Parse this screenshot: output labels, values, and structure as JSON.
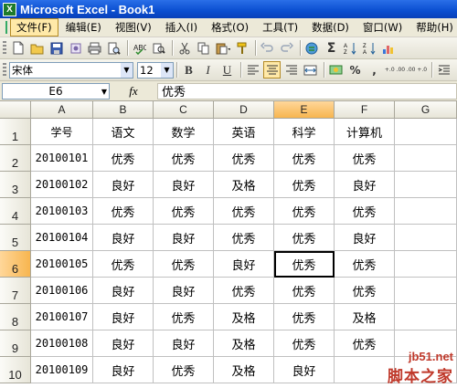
{
  "window": {
    "title": "Microsoft Excel - Book1",
    "logo": "X"
  },
  "menu": [
    "文件(F)",
    "编辑(E)",
    "视图(V)",
    "插入(I)",
    "格式(O)",
    "工具(T)",
    "数据(D)",
    "窗口(W)",
    "帮助(H)"
  ],
  "toolbar1": {
    "icons": [
      "new-icon",
      "open-icon",
      "save-icon",
      "permission-icon",
      "print-icon",
      "print-preview-icon",
      "spelling-icon",
      "research-icon",
      "cut-icon",
      "copy-icon",
      "paste-icon",
      "format-painter-icon",
      "undo-icon",
      "redo-icon",
      "hyperlink-icon",
      "autosum-icon",
      "sort-ascending-icon",
      "sort-descending-icon",
      "chart-wizard-icon"
    ],
    "autosum_glyph": "Σ"
  },
  "toolbar2": {
    "font_name": "宋体",
    "font_size": "12",
    "bold": "B",
    "italic": "I",
    "underline": "U",
    "percent": "%",
    "comma": ",",
    "inc_decimal": "+.0 .00",
    "dec_decimal": ".00 +.0"
  },
  "formula_bar": {
    "name_box": "E6",
    "fx": "fx",
    "value": "优秀"
  },
  "sheet": {
    "columns": [
      "A",
      "B",
      "C",
      "D",
      "E",
      "F",
      "G"
    ],
    "rows": [
      "1",
      "2",
      "3",
      "4",
      "5",
      "6",
      "7",
      "8",
      "9",
      "10"
    ],
    "active_cell": "E6",
    "cells": [
      [
        "学号",
        "语文",
        "数学",
        "英语",
        "科学",
        "计算机",
        ""
      ],
      [
        "20100101",
        "优秀",
        "优秀",
        "优秀",
        "优秀",
        "优秀",
        ""
      ],
      [
        "20100102",
        "良好",
        "良好",
        "及格",
        "优秀",
        "良好",
        ""
      ],
      [
        "20100103",
        "优秀",
        "优秀",
        "优秀",
        "优秀",
        "优秀",
        ""
      ],
      [
        "20100104",
        "良好",
        "良好",
        "优秀",
        "优秀",
        "良好",
        ""
      ],
      [
        "20100105",
        "优秀",
        "优秀",
        "良好",
        "优秀",
        "优秀",
        ""
      ],
      [
        "20100106",
        "良好",
        "良好",
        "优秀",
        "优秀",
        "优秀",
        ""
      ],
      [
        "20100107",
        "良好",
        "优秀",
        "及格",
        "优秀",
        "及格",
        ""
      ],
      [
        "20100108",
        "良好",
        "良好",
        "及格",
        "优秀",
        "优秀",
        ""
      ],
      [
        "20100109",
        "良好",
        "优秀",
        "及格",
        "良好",
        "",
        ""
      ]
    ]
  },
  "watermark": {
    "url": "jb51.net",
    "name": "脚本之家"
  }
}
